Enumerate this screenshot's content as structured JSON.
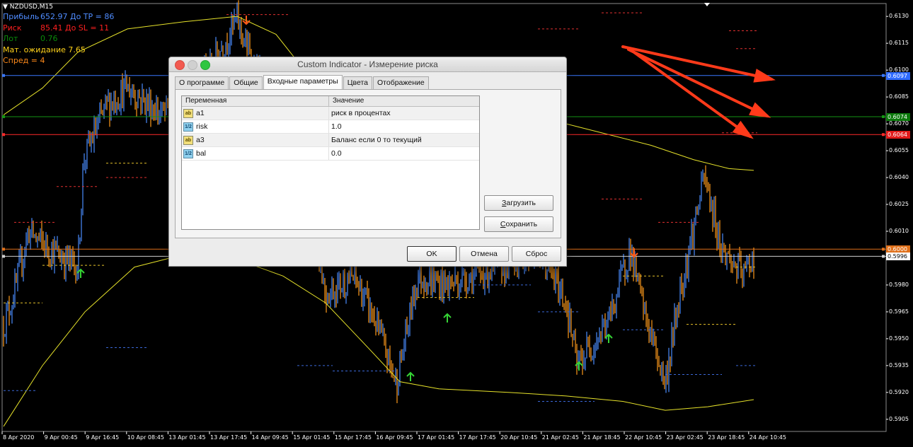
{
  "chart": {
    "symbol": "NZDUSD,M15",
    "info_lines": [
      {
        "label": "Прибыль",
        "value": "652.97 До TP = 86",
        "color": "#4f8cff"
      },
      {
        "label": "Риск",
        "value": "85.41 До SL = 11",
        "color": "#ff2020"
      },
      {
        "label": "Лот",
        "value": "0.76",
        "color": "#0a8a0a"
      },
      {
        "label": "Мат. ожидание 7.65",
        "value": "",
        "color": "#ffd21a"
      },
      {
        "label": "Спред = 4",
        "value": "",
        "color": "#ff8a1a"
      }
    ],
    "price_ticks": [
      "0.6130",
      "0.6115",
      "0.6100",
      "0.6085",
      "0.6070",
      "0.6055",
      "0.6040",
      "0.6025",
      "0.6010",
      "0.5995",
      "0.5980",
      "0.5965",
      "0.5950",
      "0.5935",
      "0.5920",
      "0.5905"
    ],
    "price_ticks_y": [
      0.613,
      0.6115,
      0.61,
      0.6085,
      0.607,
      0.6055,
      0.604,
      0.6025,
      0.601,
      0.5995,
      0.598,
      0.5965,
      0.595,
      0.5935,
      0.592,
      0.5905
    ],
    "time_ticks": [
      "8 Apr 2020",
      "9 Apr 00:45",
      "9 Apr 16:45",
      "10 Apr 08:45",
      "13 Apr 01:45",
      "13 Apr 17:45",
      "14 Apr 09:45",
      "15 Apr 01:45",
      "15 Apr 17:45",
      "16 Apr 09:45",
      "17 Apr 01:45",
      "17 Apr 17:45",
      "20 Apr 10:45",
      "21 Apr 02:45",
      "21 Apr 18:45",
      "22 Apr 10:45",
      "23 Apr 02:45",
      "23 Apr 18:45",
      "24 Apr 10:45"
    ],
    "levels": [
      {
        "price": 0.6097,
        "label": "0.6097",
        "color": "#2f6bff",
        "text_color": "#ffffff",
        "line": "#3a78ff"
      },
      {
        "price": 0.6074,
        "label": "0.6074",
        "color": "#0c7a0c",
        "text_color": "#ffffff",
        "line": "#159515"
      },
      {
        "price": 0.6064,
        "label": "0.6064",
        "color": "#e21a1a",
        "text_color": "#ffffff",
        "line": "#ff2a2a"
      },
      {
        "price": 0.6,
        "label": "0.6000",
        "color": "#e0701a",
        "text_color": "#ffffff",
        "line": "#e0701a"
      },
      {
        "price": 0.5996,
        "label": "0.5996",
        "color": "#ffffff",
        "text_color": "#000000",
        "line": "#cfcfcf"
      }
    ],
    "colors": {
      "up": "#4a8cff",
      "down": "#ff9b1a",
      "envelope": "#e6e22a",
      "arrow_up": "#35d435",
      "arrow_down": "#ff5a1a",
      "annotation": "#ff3a1a"
    }
  },
  "dialog": {
    "title": "Custom Indicator - Измерение риска",
    "tabs": [
      "О программе",
      "Общие",
      "Входные параметры",
      "Цвета",
      "Отображение"
    ],
    "active_tab": 2,
    "columns": [
      "Переменная",
      "Значение"
    ],
    "rows": [
      {
        "type": "ab",
        "name": "a1",
        "value": "риск в процентах"
      },
      {
        "type": "num",
        "name": "risk",
        "value": "1.0"
      },
      {
        "type": "ab",
        "name": "a3",
        "value": "Баланс если 0 то текущий"
      },
      {
        "type": "num",
        "name": "bal",
        "value": "0.0"
      }
    ],
    "icon_ab": "ab",
    "icon_num": "1/2",
    "load_first": "З",
    "load_rest": "агрузить",
    "save_first": "С",
    "save_rest": "охранить",
    "ok": "OK",
    "cancel": "Отмена",
    "reset": "Сброс"
  }
}
